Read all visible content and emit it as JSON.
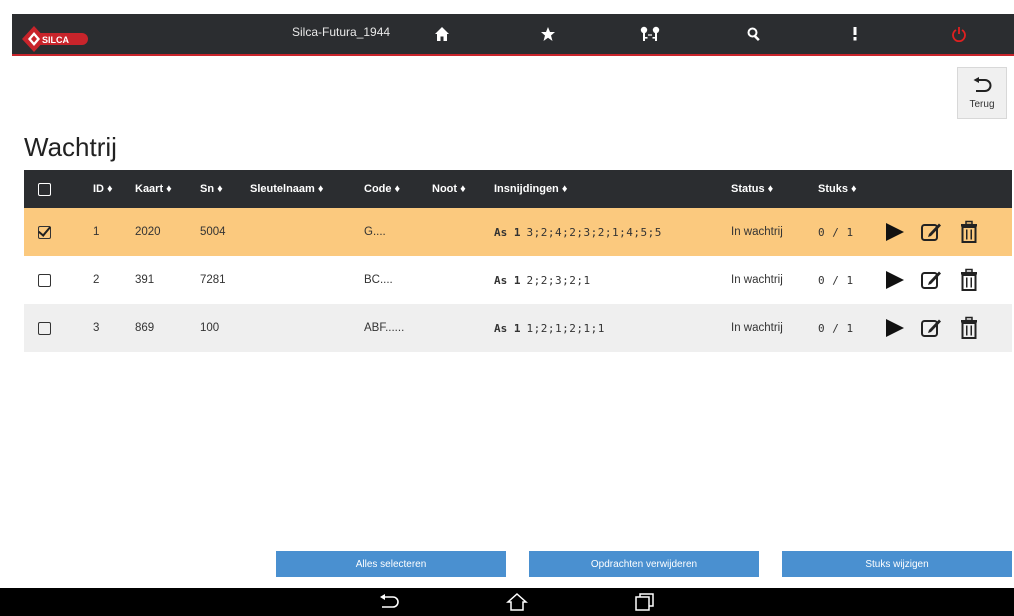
{
  "topbar": {
    "device_name": "Silca-Futura_1944",
    "logo_text": "SILCA",
    "icons": [
      "home-icon",
      "star-icon",
      "keys-icon",
      "search-icon",
      "more-vertical-icon",
      "power-icon"
    ],
    "accent_color": "#c8242b"
  },
  "back_button": {
    "label": "Terug"
  },
  "page": {
    "title": "Wachtrij"
  },
  "table": {
    "headers": {
      "id": "ID ♦",
      "kaart": "Kaart ♦",
      "sn": "Sn ♦",
      "sleutelnaam": "Sleutelnaam ♦",
      "code": "Code ♦",
      "noot": "Noot ♦",
      "insnijdingen": "Insnijdingen ♦",
      "status": "Status ♦",
      "stuks": "Stuks ♦"
    },
    "rows": [
      {
        "selected": true,
        "id": "1",
        "kaart": "2020",
        "sn": "5004",
        "sleutelnaam": "",
        "code": "G....",
        "noot": "",
        "axis": "As 1",
        "cuts": "3;2;4;2;3;2;1;4;5;5",
        "status": "In wachtrij",
        "stuks": "0 / 1"
      },
      {
        "selected": false,
        "id": "2",
        "kaart": "391",
        "sn": "7281",
        "sleutelnaam": "",
        "code": "BC....",
        "noot": "",
        "axis": "As 1",
        "cuts": "2;2;3;2;1",
        "status": "In wachtrij",
        "stuks": "0 / 1"
      },
      {
        "selected": false,
        "id": "3",
        "kaart": "869",
        "sn": "100",
        "sleutelnaam": "",
        "code": "ABF......",
        "noot": "",
        "axis": "As 1",
        "cuts": "1;2;1;2;1;1",
        "status": "In wachtrij",
        "stuks": "0 / 1"
      }
    ],
    "row_colors": {
      "selected": "#fbc97e",
      "alt": "#efefef",
      "header": "#2b2d30"
    }
  },
  "bottom_buttons": {
    "select_all": "Alles selecteren",
    "delete_jobs": "Opdrachten verwijderen",
    "change_pieces": "Stuks wijzigen",
    "color": "#4a90d0"
  }
}
